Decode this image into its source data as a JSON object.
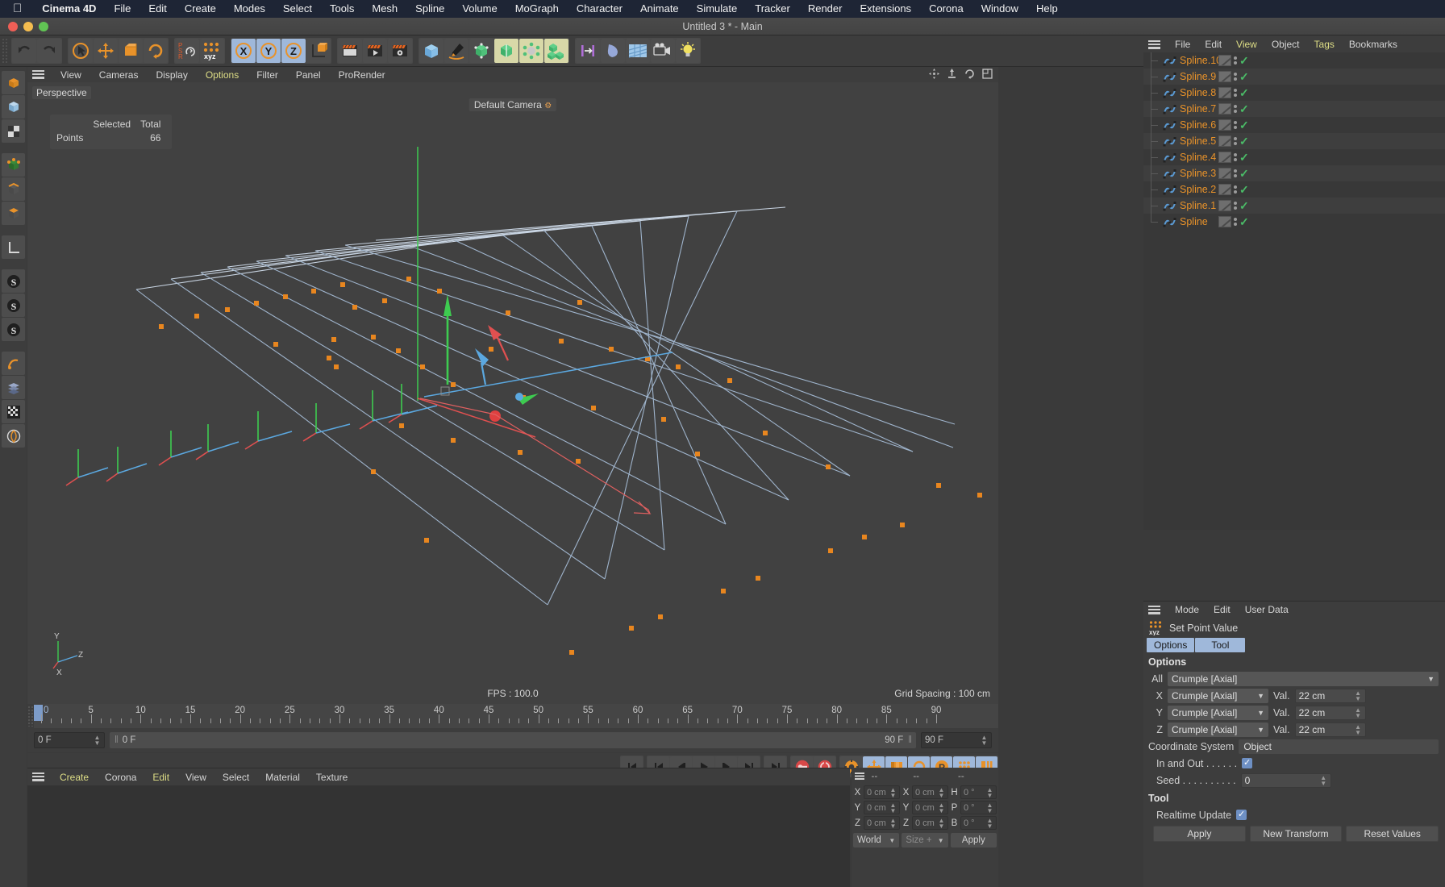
{
  "macmenu": {
    "apple": "apple-logo",
    "items": [
      "Cinema 4D",
      "File",
      "Edit",
      "Create",
      "Modes",
      "Select",
      "Tools",
      "Mesh",
      "Spline",
      "Volume",
      "MoGraph",
      "Character",
      "Animate",
      "Simulate",
      "Tracker",
      "Render",
      "Extensions",
      "Corona",
      "Window",
      "Help"
    ]
  },
  "window": {
    "title": "Untitled 3 * - Main"
  },
  "viewport_menu": {
    "items": [
      "View",
      "Cameras",
      "Display",
      "Options",
      "Filter",
      "Panel",
      "ProRender"
    ],
    "active": "Options"
  },
  "viewport": {
    "perspective_label": "Perspective",
    "camera_label": "Default Camera",
    "fps_label": "FPS : 100.0",
    "grid_label": "Grid Spacing : 100 cm",
    "stats": {
      "col_selected": "Selected",
      "col_total": "Total",
      "row_label": "Points",
      "selected": "",
      "total": "66"
    },
    "axis": {
      "x": "X",
      "y": "Y",
      "z": "Z"
    }
  },
  "timeline": {
    "ticks": [
      0,
      5,
      10,
      15,
      20,
      25,
      30,
      35,
      40,
      45,
      50,
      55,
      60,
      65,
      70,
      75,
      80,
      85,
      90
    ],
    "current_frame": "0 F",
    "preview_frame": "0 F",
    "end_frame_left": "90 F",
    "end_frame_right": "90 F",
    "playhead": 0
  },
  "object_manager": {
    "menu": [
      "File",
      "Edit",
      "View",
      "Object",
      "Tags",
      "Bookmarks"
    ],
    "active_menu": [
      "View",
      "Tags"
    ],
    "objects": [
      {
        "name": "Spline.10"
      },
      {
        "name": "Spline.9"
      },
      {
        "name": "Spline.8"
      },
      {
        "name": "Spline.7"
      },
      {
        "name": "Spline.6"
      },
      {
        "name": "Spline.5"
      },
      {
        "name": "Spline.4"
      },
      {
        "name": "Spline.3"
      },
      {
        "name": "Spline.2"
      },
      {
        "name": "Spline.1"
      },
      {
        "name": "Spline"
      }
    ]
  },
  "attribute_manager": {
    "menu": [
      "Mode",
      "Edit",
      "User Data"
    ],
    "title": "Set Point Value",
    "tabs": [
      "Options",
      "Tool"
    ],
    "options_header": "Options",
    "rows": [
      {
        "label": "All",
        "value": "Crumple [Axial]"
      },
      {
        "label": "X",
        "value": "Crumple [Axial]",
        "val_label": "Val.",
        "val": "22 cm"
      },
      {
        "label": "Y",
        "value": "Crumple [Axial]",
        "val_label": "Val.",
        "val": "22 cm"
      },
      {
        "label": "Z",
        "value": "Crumple [Axial]",
        "val_label": "Val.",
        "val": "22 cm"
      }
    ],
    "coordinate_system_label": "Coordinate System",
    "coordinate_system_value": "Object",
    "in_and_out_label": "In and Out . . . . . .",
    "in_and_out_checked": true,
    "seed_label": "Seed . . . . . . . . . .",
    "seed_value": "0",
    "tool_header": "Tool",
    "realtime_label": "Realtime Update",
    "realtime_checked": true,
    "buttons": [
      "Apply",
      "New Transform",
      "Reset Values"
    ]
  },
  "material_manager": {
    "menu": [
      "Create",
      "Corona",
      "Edit",
      "View",
      "Select",
      "Material",
      "Texture"
    ],
    "active_menu": [
      "Create",
      "Edit"
    ]
  },
  "coordinates": {
    "headers": [
      "--",
      "--",
      "--"
    ],
    "position": [
      {
        "axis": "X",
        "value": "0 cm"
      },
      {
        "axis": "Y",
        "value": "0 cm"
      },
      {
        "axis": "Z",
        "value": "0 cm"
      }
    ],
    "size": [
      {
        "axis": "X",
        "value": "0 cm"
      },
      {
        "axis": "Y",
        "value": "0 cm"
      },
      {
        "axis": "Z",
        "value": "0 cm"
      }
    ],
    "rotation": [
      {
        "axis": "H",
        "value": "0 °"
      },
      {
        "axis": "P",
        "value": "0 °"
      },
      {
        "axis": "B",
        "value": "0 °"
      }
    ],
    "system": "World",
    "mode": "Size +",
    "apply": "Apply"
  },
  "colors": {
    "orange": "#e8922a",
    "accent_blue": "#9fb8da",
    "green_check": "#4bbd68",
    "menu_yellow": "#dede86",
    "spline_blue": "#7fa8d8",
    "point_orange": "#e8861f"
  }
}
